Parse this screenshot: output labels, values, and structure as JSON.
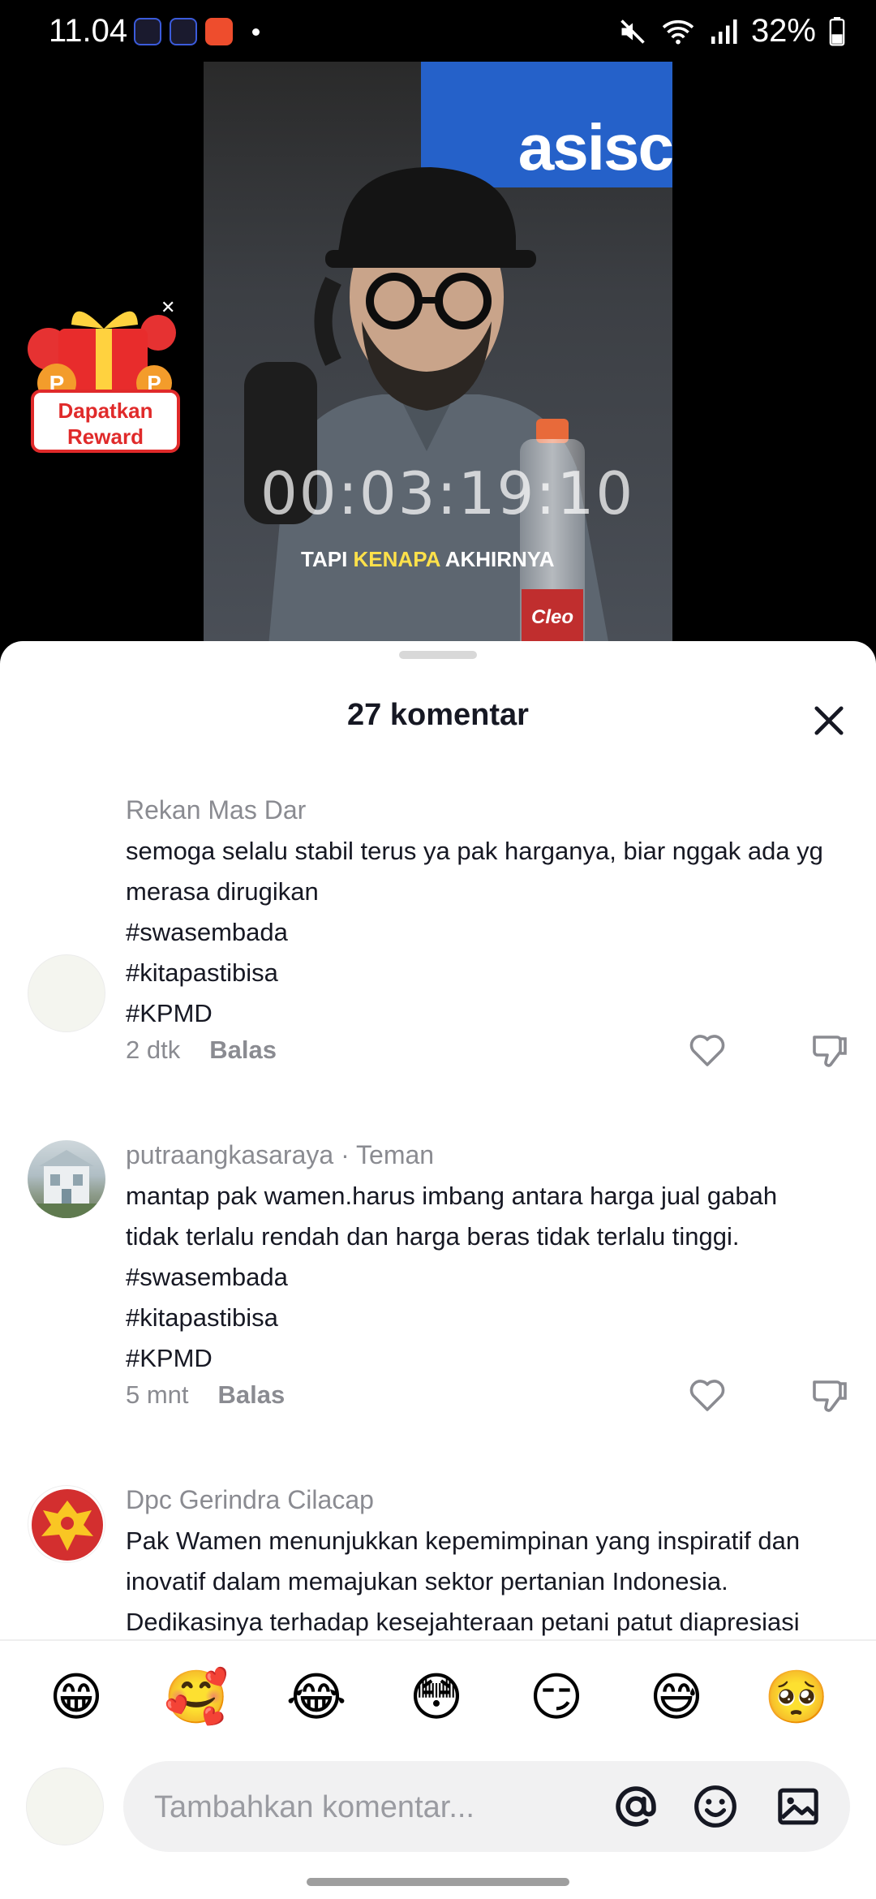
{
  "status_bar": {
    "time": "11.04",
    "battery": "32%"
  },
  "video": {
    "sign_text": "asisc",
    "timecode": "00:03:19:10",
    "subtitle_pre": "TAPI ",
    "subtitle_highlight": "KENAPA",
    "subtitle_post": " AKHIRNYA",
    "bottle_label": "Cleo"
  },
  "reward": {
    "line1": "Dapatkan",
    "line2": "Reward"
  },
  "sheet": {
    "title": "27 komentar"
  },
  "comments": [
    {
      "name": "Rekan Mas Dar",
      "lines": [
        "semoga selalu stabil terus ya pak harganya, biar nggak ada yg",
        "merasa dirugikan",
        "#swasembada",
        "#kitapastibisa",
        "#KPMD"
      ],
      "time": "2 dtk",
      "reply": "Balas"
    },
    {
      "name": "putraangkasaraya · Teman",
      "lines": [
        "mantap pak wamen.harus imbang antara harga jual gabah",
        "tidak terlalu rendah dan harga beras tidak terlalu tinggi.",
        "#swasembada",
        "#kitapastibisa",
        "#KPMD"
      ],
      "time": "5 mnt",
      "reply": "Balas"
    },
    {
      "name": "Dpc Gerindra Cilacap",
      "lines": [
        "Pak Wamen menunjukkan kepemimpinan yang inspiratif dan",
        "inovatif dalam memajukan sektor pertanian Indonesia.",
        "Dedikasinya terhadap kesejahteraan petani patut diapresiasi"
      ]
    }
  ],
  "emojis": [
    {
      "name": "grin",
      "glyph": "😁"
    },
    {
      "name": "smiling-hearts",
      "glyph": "🥰"
    },
    {
      "name": "tears-of-joy",
      "glyph": "😂"
    },
    {
      "name": "flushed",
      "glyph": "😳"
    },
    {
      "name": "smirk",
      "glyph": "😏"
    },
    {
      "name": "sweat-smile",
      "glyph": "😅"
    },
    {
      "name": "pleading",
      "glyph": "🥺"
    }
  ],
  "input": {
    "placeholder": "Tambahkan komentar..."
  },
  "icons": {
    "like": "heart-icon",
    "dislike": "thumbs-down-icon",
    "mention": "at-icon",
    "emoji": "smiley-icon",
    "image": "image-icon",
    "close": "close-icon"
  }
}
